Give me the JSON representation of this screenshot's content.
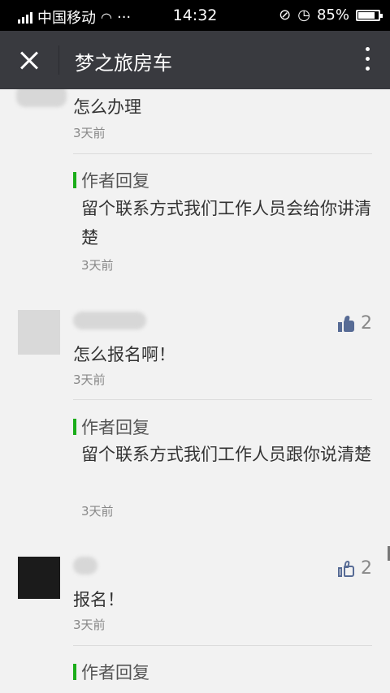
{
  "status_bar": {
    "carrier": "中国移动",
    "time": "14:32",
    "battery": "85%"
  },
  "header": {
    "title": "梦之旅房车"
  },
  "comments": [
    {
      "text": "怎么办理",
      "time": "3天前",
      "reply": {
        "label": "作者回复",
        "text": "留个联系方式我们工作人员会给你讲清楚",
        "time": "3天前"
      }
    },
    {
      "likes": "2",
      "text": "怎么报名啊！",
      "time": "3天前",
      "reply": {
        "label": "作者回复",
        "text": "留个联系方式我们工作人员跟你说清楚",
        "time": "3天前"
      }
    },
    {
      "likes": "2",
      "text": "报名！",
      "time": "3天前",
      "reply": {
        "label": "作者回复"
      }
    }
  ]
}
